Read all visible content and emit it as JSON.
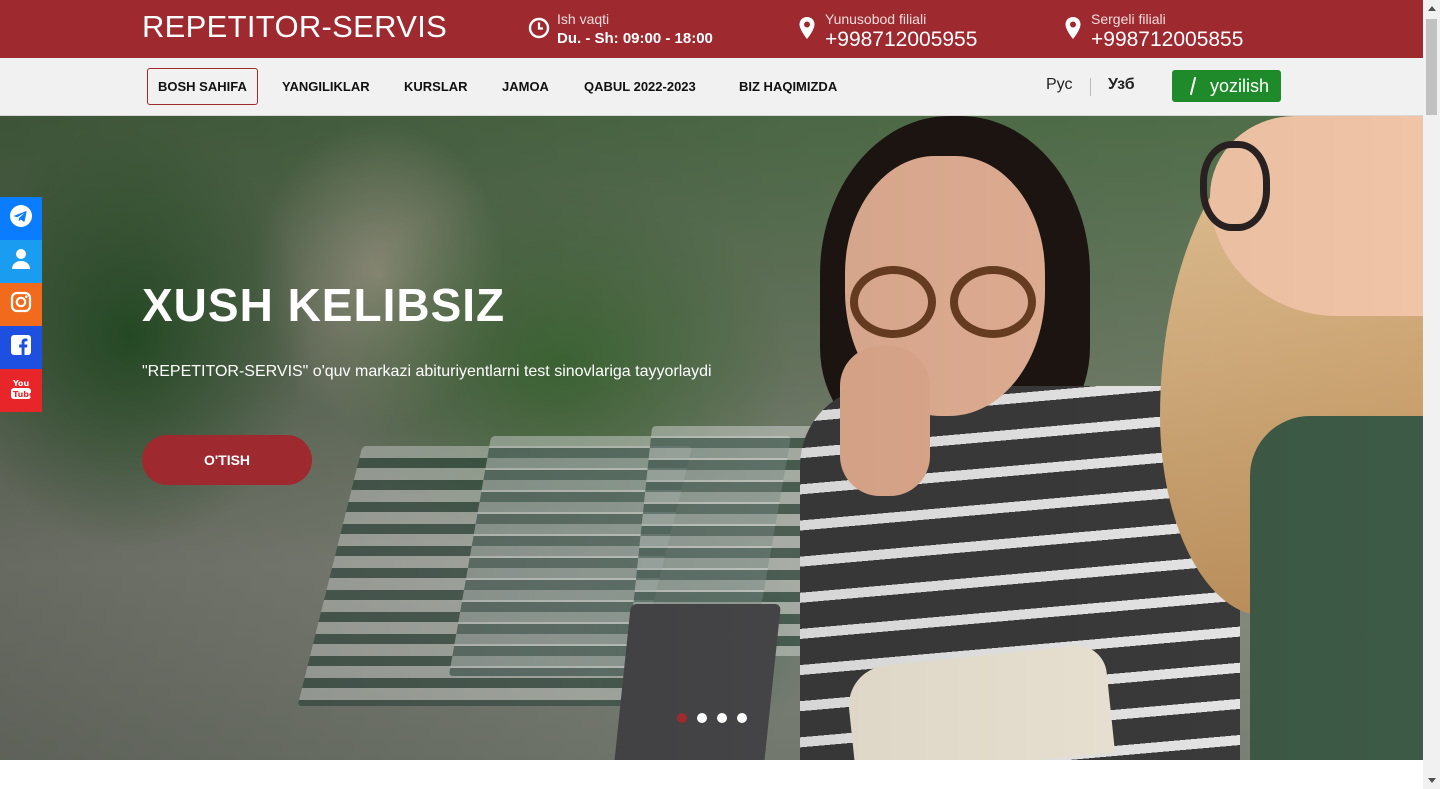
{
  "brand": {
    "name": "REPETITOR-SERVIS"
  },
  "header": {
    "hours": {
      "label": "Ish vaqti",
      "value": "Du. - Sh: 09:00 - 18:00",
      "icon": "clock-icon"
    },
    "branch1": {
      "label": "Yunusobod filiali",
      "phone": "+998712005955",
      "icon": "map-pin-icon"
    },
    "branch2": {
      "label": "Sergeli filiali",
      "phone": "+998712005855",
      "icon": "map-pin-icon"
    }
  },
  "nav": {
    "items": [
      {
        "label": "BOSH SAHIFA",
        "active": true
      },
      {
        "label": "YANGILIKLAR"
      },
      {
        "label": "KURSLAR"
      },
      {
        "label": "JAMOA"
      },
      {
        "label": "QABUL 2022-2023"
      },
      {
        "label": "BIZ HAQIMIZDA"
      }
    ],
    "lang_ru": "Рус",
    "lang_uz": "Узб",
    "signup_label": "yozilish",
    "signup_icon": "pen-icon"
  },
  "hero": {
    "title": "XUSH KELIBSIZ",
    "subtitle": "\"REPETITOR-SERVIS\" o'quv markazi abituriyentlarni test sinovlariga tayyorlaydi",
    "button_label": "O'TISH",
    "slides_count": 4,
    "active_slide": 1
  },
  "social": [
    {
      "name": "telegram-icon",
      "color": "#0a7cff"
    },
    {
      "name": "user-icon",
      "color": "#1a9cf0"
    },
    {
      "name": "instagram-icon",
      "color": "#f26b1d"
    },
    {
      "name": "facebook-icon",
      "color": "#1d4fe0"
    },
    {
      "name": "youtube-icon",
      "color": "#e8262a"
    }
  ],
  "colors": {
    "brand": "#9e2a30",
    "signup": "#1f8a2a",
    "nav_bg": "#f1f1f1"
  }
}
